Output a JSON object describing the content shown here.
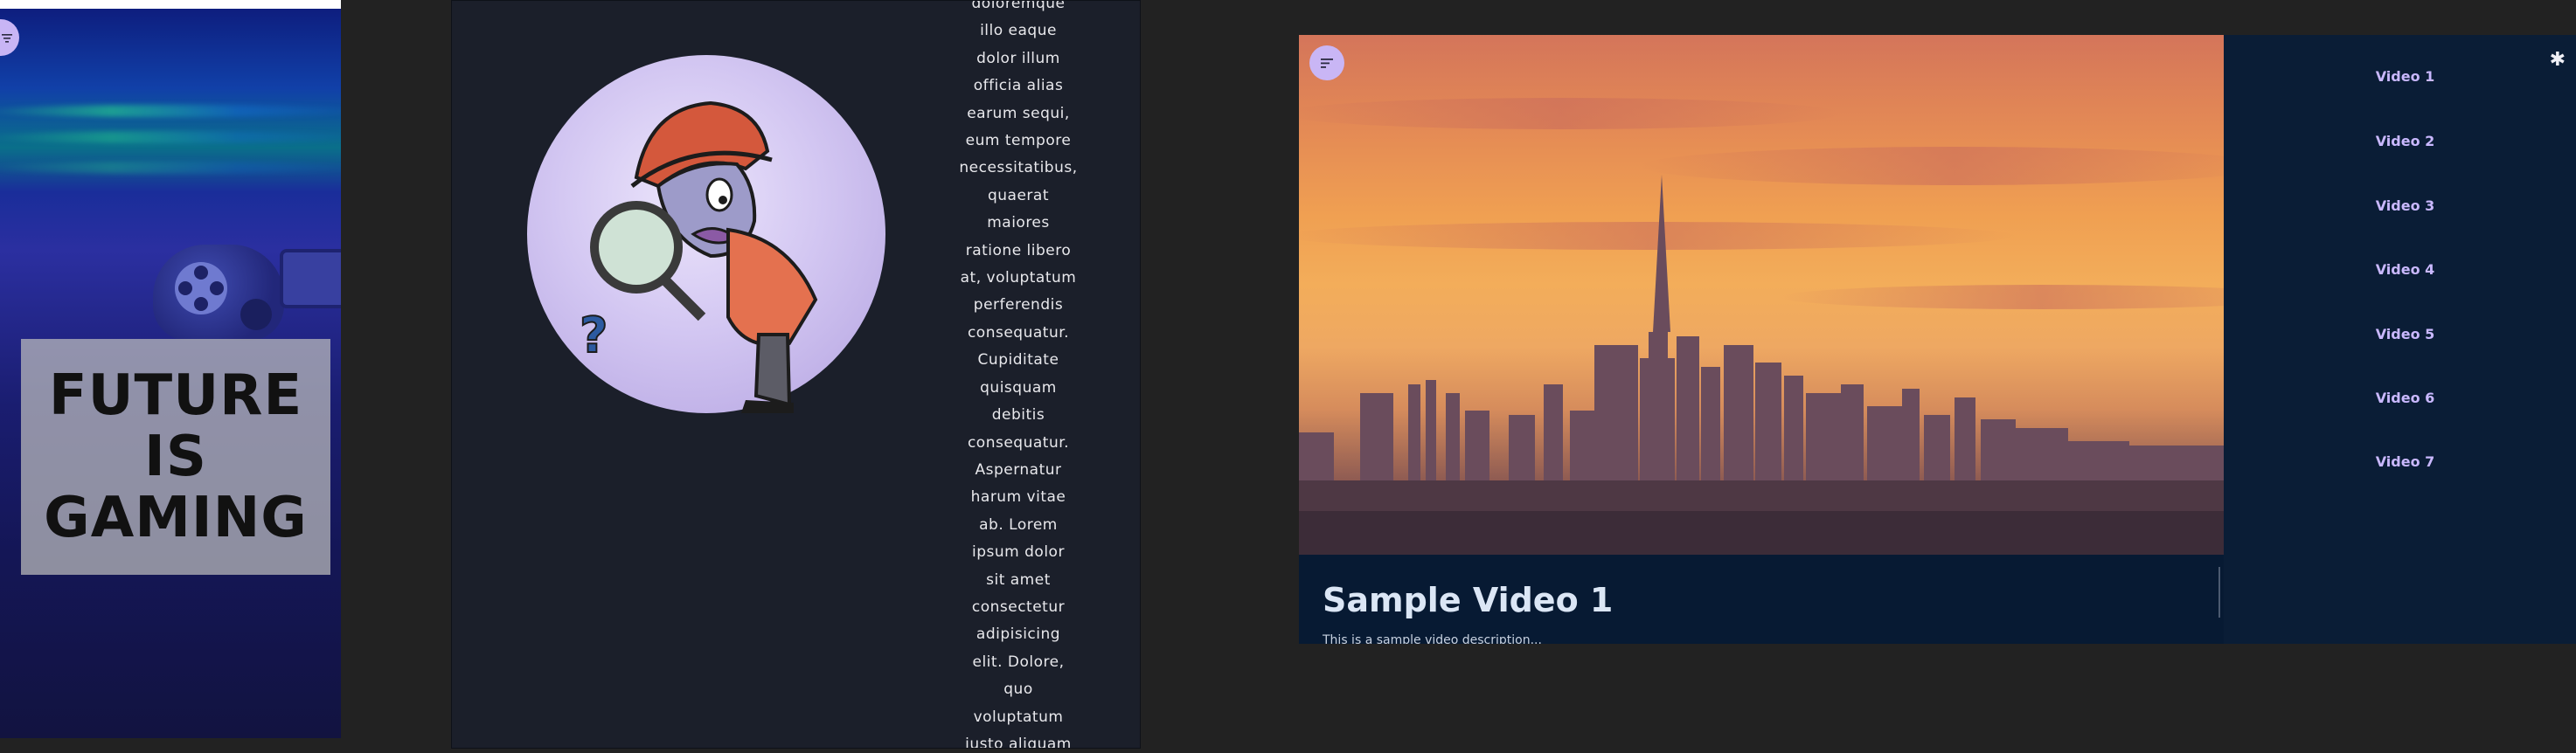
{
  "gaming_card": {
    "headline": "FUTURE\nIS\nGAMING",
    "menu_icon": "filter-lines-icon"
  },
  "article": {
    "lines": [
      "doloremque",
      "illo eaque",
      "dolor illum",
      "officia alias",
      "earum sequi,",
      "eum tempore",
      "necessitatibus,",
      "quaerat",
      "maiores",
      "ratione libero",
      "at, voluptatum",
      "perferendis",
      "consequatur.",
      "Cupiditate",
      "quisquam",
      "debitis",
      "consequatur.",
      "Aspernatur",
      "harum vitae",
      "ab. Lorem",
      "ipsum dolor",
      "sit amet",
      "consectetur",
      "adipisicing",
      "elit. Dolore,",
      "quo",
      "voluptatum",
      "iusto aliquam"
    ],
    "illustration": "detective-with-magnifying-glass"
  },
  "video_player": {
    "title": "Sample Video 1",
    "description": "This is a sample video description...",
    "menu_icon": "filter-lines-icon",
    "settings_icon": "gear-icon",
    "playlist": [
      {
        "label": "Video 1"
      },
      {
        "label": "Video 2"
      },
      {
        "label": "Video 3"
      },
      {
        "label": "Video 4"
      },
      {
        "label": "Video 5"
      },
      {
        "label": "Video 6"
      },
      {
        "label": "Video 7"
      }
    ]
  },
  "colors": {
    "accent": "#c9b6f5",
    "playlist_text": "#c9b8ff",
    "page_bg": "#222222",
    "panel_dark": "#1b1f2a",
    "player_bg": "#0c1c33"
  }
}
